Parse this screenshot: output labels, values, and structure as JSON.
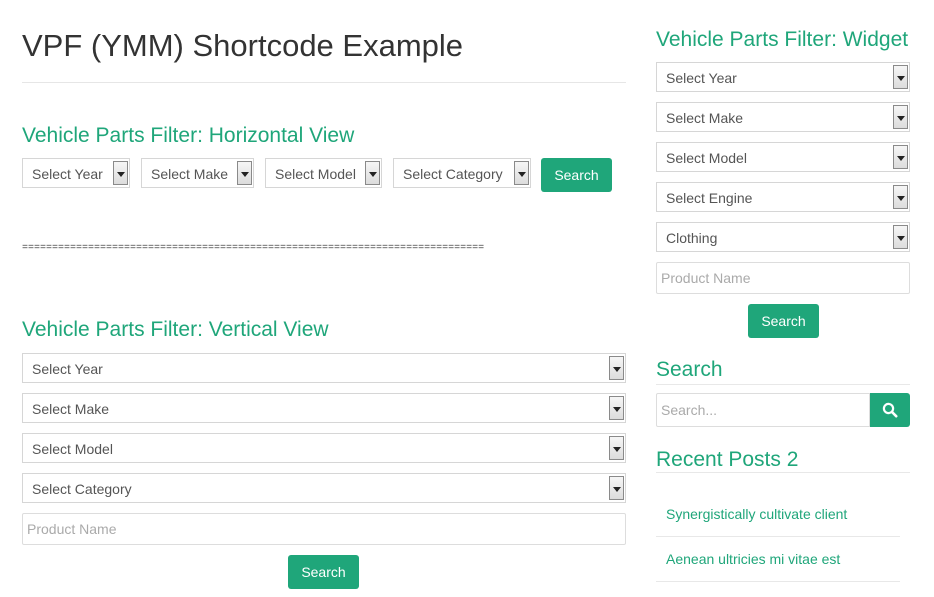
{
  "page": {
    "title": "VPF (YMM) Shortcode Example",
    "separator": "============================================================================="
  },
  "horizontal": {
    "heading": "Vehicle Parts Filter: Horizontal View",
    "year": "Select Year",
    "make": "Select Make",
    "model": "Select Model",
    "category": "Select Category",
    "search_label": "Search"
  },
  "vertical": {
    "heading": "Vehicle Parts Filter: Vertical View",
    "year": "Select Year",
    "make": "Select Make",
    "model": "Select Model",
    "category": "Select Category",
    "product_placeholder": "Product Name",
    "search_label": "Search"
  },
  "widget": {
    "heading": "Vehicle Parts Filter: Widget",
    "year": "Select Year",
    "make": "Select Make",
    "model": "Select Model",
    "engine": "Select Engine",
    "category": "Clothing",
    "product_placeholder": "Product Name",
    "search_label": "Search"
  },
  "search_widget": {
    "heading": "Search",
    "placeholder": "Search...",
    "icon": "search-icon"
  },
  "recent_posts": {
    "heading": "Recent Posts 2",
    "items": [
      "Synergistically cultivate client",
      "Aenean ultricies mi vitae est"
    ]
  },
  "colors": {
    "accent": "#1fa67a",
    "text": "#333333"
  }
}
